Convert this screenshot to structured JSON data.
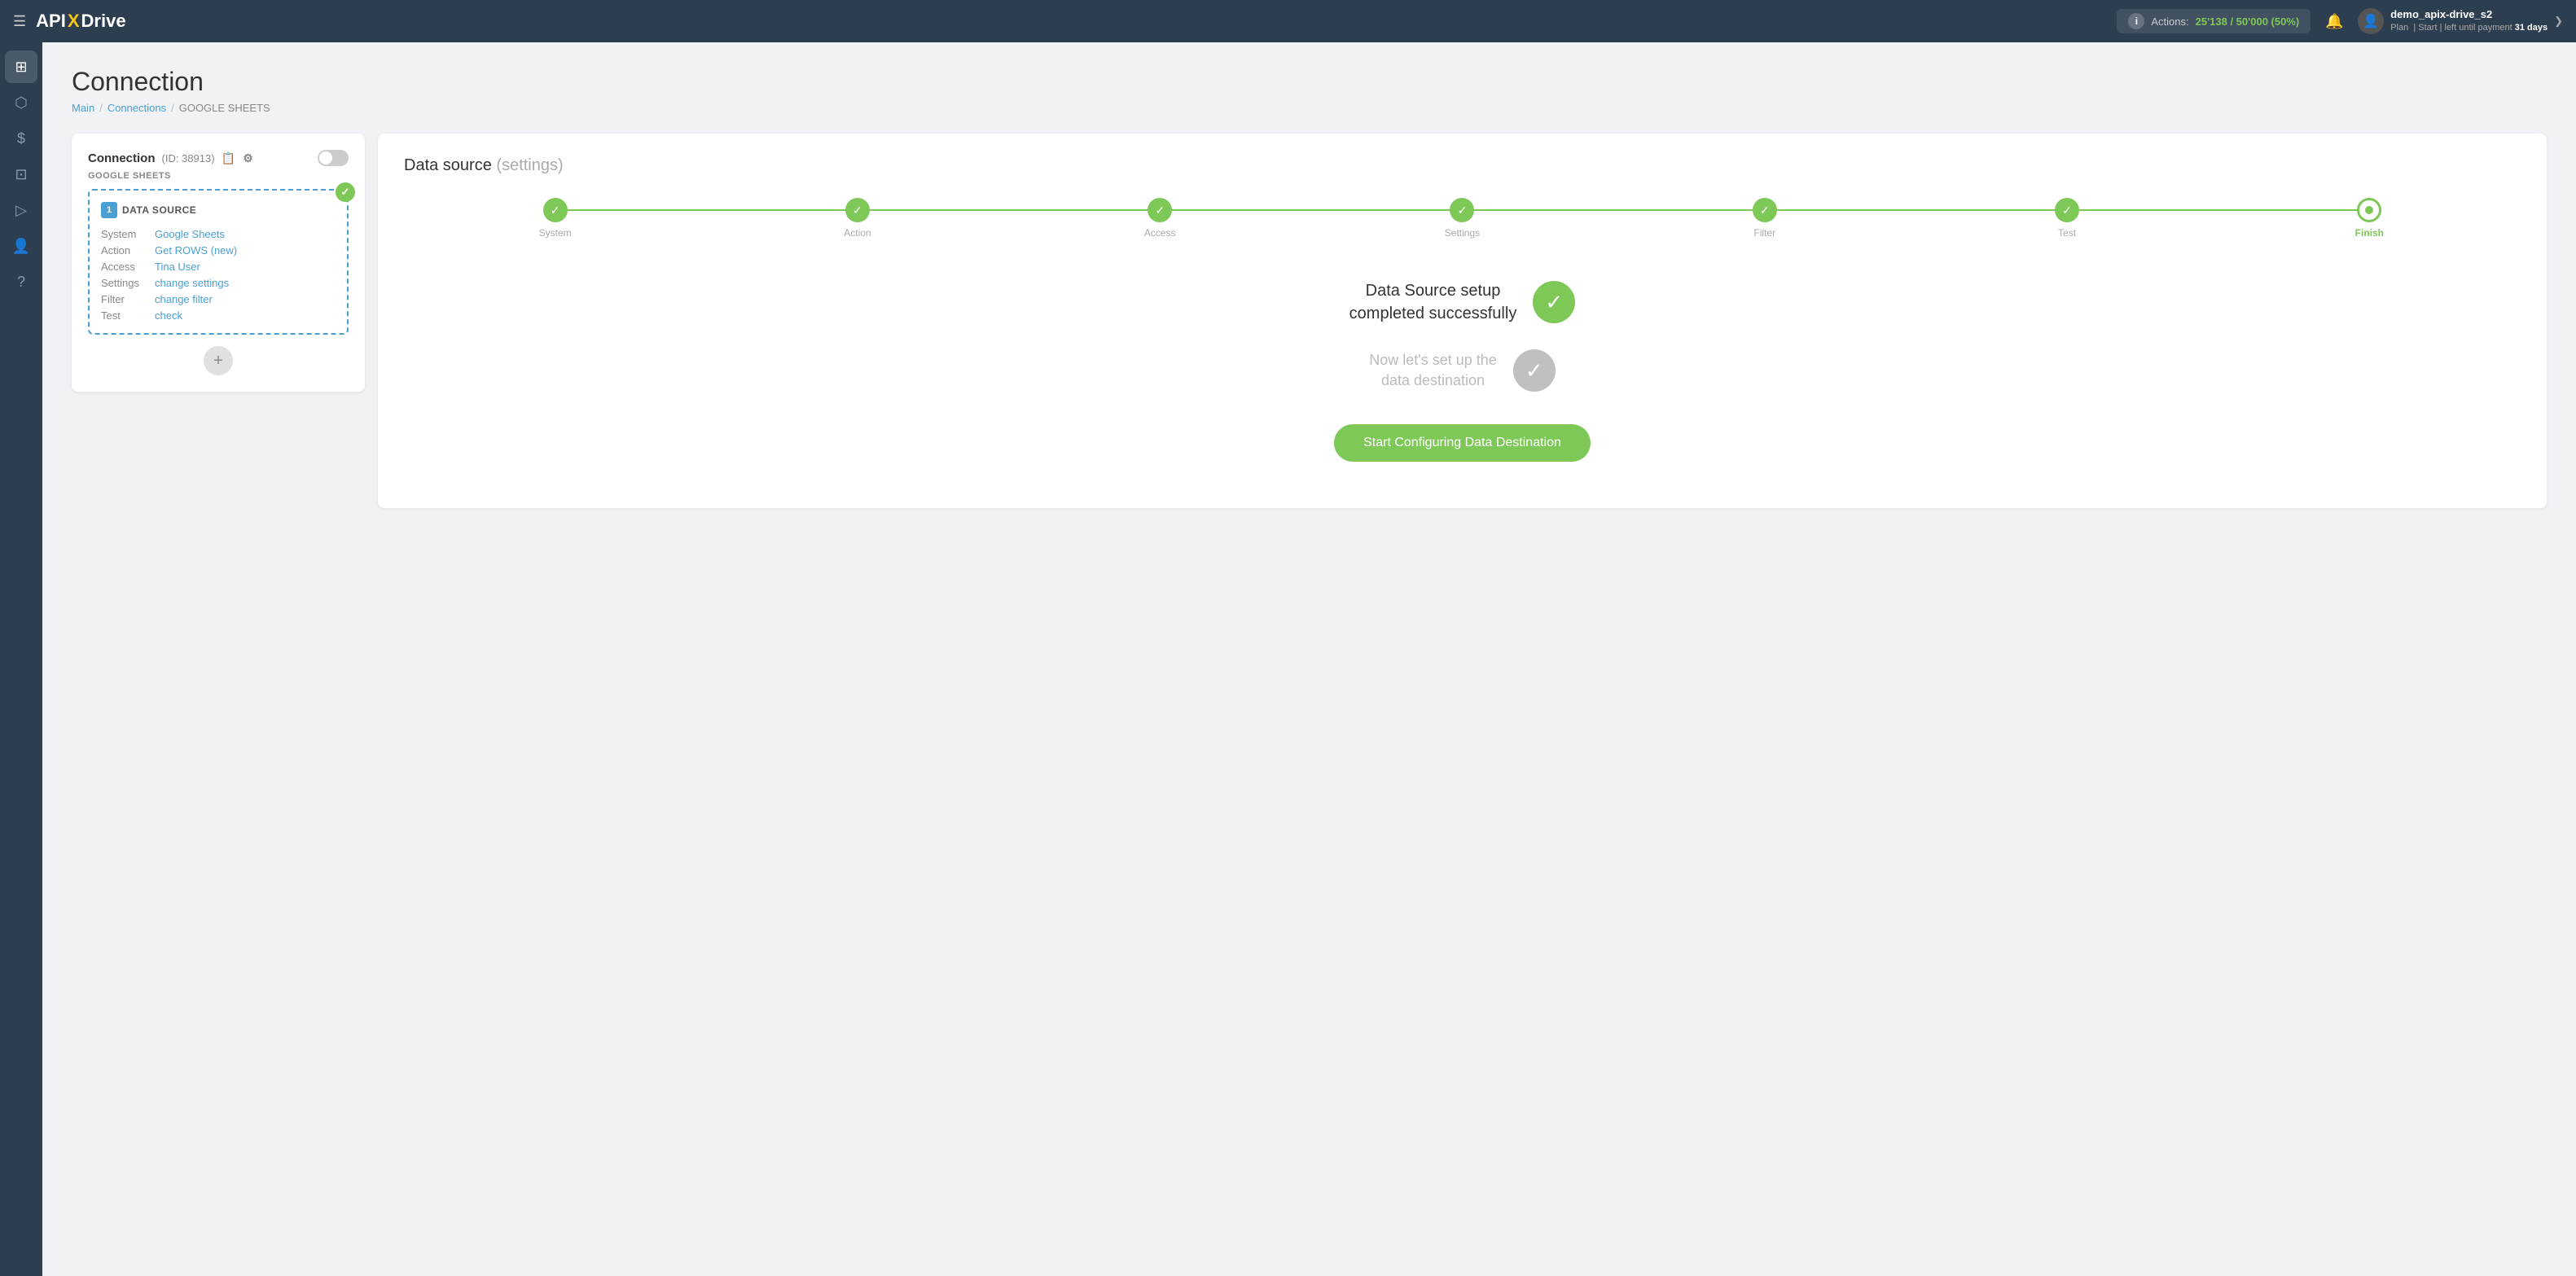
{
  "topnav": {
    "logo_text": "API",
    "logo_x": "X",
    "logo_rest": "Drive",
    "menu_icon": "☰",
    "actions_label": "Actions:",
    "actions_count": "25'138 / 50'000 (50%)",
    "bell_icon": "🔔",
    "user_avatar_icon": "👤",
    "username": "demo_apix-drive_s2",
    "plan_label": "Plan",
    "plan_type": "Start",
    "plan_days_label": "left until payment",
    "plan_days": "31 days",
    "chevron_icon": "❯"
  },
  "sidebar": {
    "items": [
      {
        "id": "home",
        "icon": "⊞",
        "label": "Home"
      },
      {
        "id": "connections",
        "icon": "⬡",
        "label": "Connections"
      },
      {
        "id": "billing",
        "icon": "$",
        "label": "Billing"
      },
      {
        "id": "tools",
        "icon": "⊡",
        "label": "Tools"
      },
      {
        "id": "watch",
        "icon": "▷",
        "label": "Watch"
      },
      {
        "id": "profile",
        "icon": "👤",
        "label": "Profile"
      },
      {
        "id": "help",
        "icon": "?",
        "label": "Help"
      }
    ]
  },
  "page": {
    "title": "Connection",
    "breadcrumb": {
      "main": "Main",
      "connections": "Connections",
      "current": "GOOGLE SHEETS"
    }
  },
  "left_panel": {
    "title": "Connection",
    "id_label": "(ID: 38913)",
    "copy_icon": "📋",
    "settings_icon": "⚙",
    "source_label": "GOOGLE SHEETS",
    "datasource_card": {
      "num": "1",
      "type": "DATA SOURCE",
      "rows": [
        {
          "label": "System",
          "value": "Google Sheets"
        },
        {
          "label": "Action",
          "value": "Get ROWS (new)"
        },
        {
          "label": "Access",
          "value": "Tina User"
        },
        {
          "label": "Settings",
          "value": "change settings"
        },
        {
          "label": "Filter",
          "value": "change filter"
        },
        {
          "label": "Test",
          "value": "check"
        }
      ],
      "badge": "✓"
    },
    "add_icon": "+"
  },
  "right_panel": {
    "title": "Data source",
    "title_sub": "(settings)",
    "steps": [
      {
        "id": "system",
        "label": "System",
        "state": "done"
      },
      {
        "id": "action",
        "label": "Action",
        "state": "done"
      },
      {
        "id": "access",
        "label": "Access",
        "state": "done"
      },
      {
        "id": "settings",
        "label": "Settings",
        "state": "done"
      },
      {
        "id": "filter",
        "label": "Filter",
        "state": "done"
      },
      {
        "id": "test",
        "label": "Test",
        "state": "done"
      },
      {
        "id": "finish",
        "label": "Finish",
        "state": "active"
      }
    ],
    "success_title": "Data Source setup\ncompleted successfully",
    "next_title": "Now let's set up the\ndata destination",
    "start_button": "Start Configuring Data Destination"
  }
}
